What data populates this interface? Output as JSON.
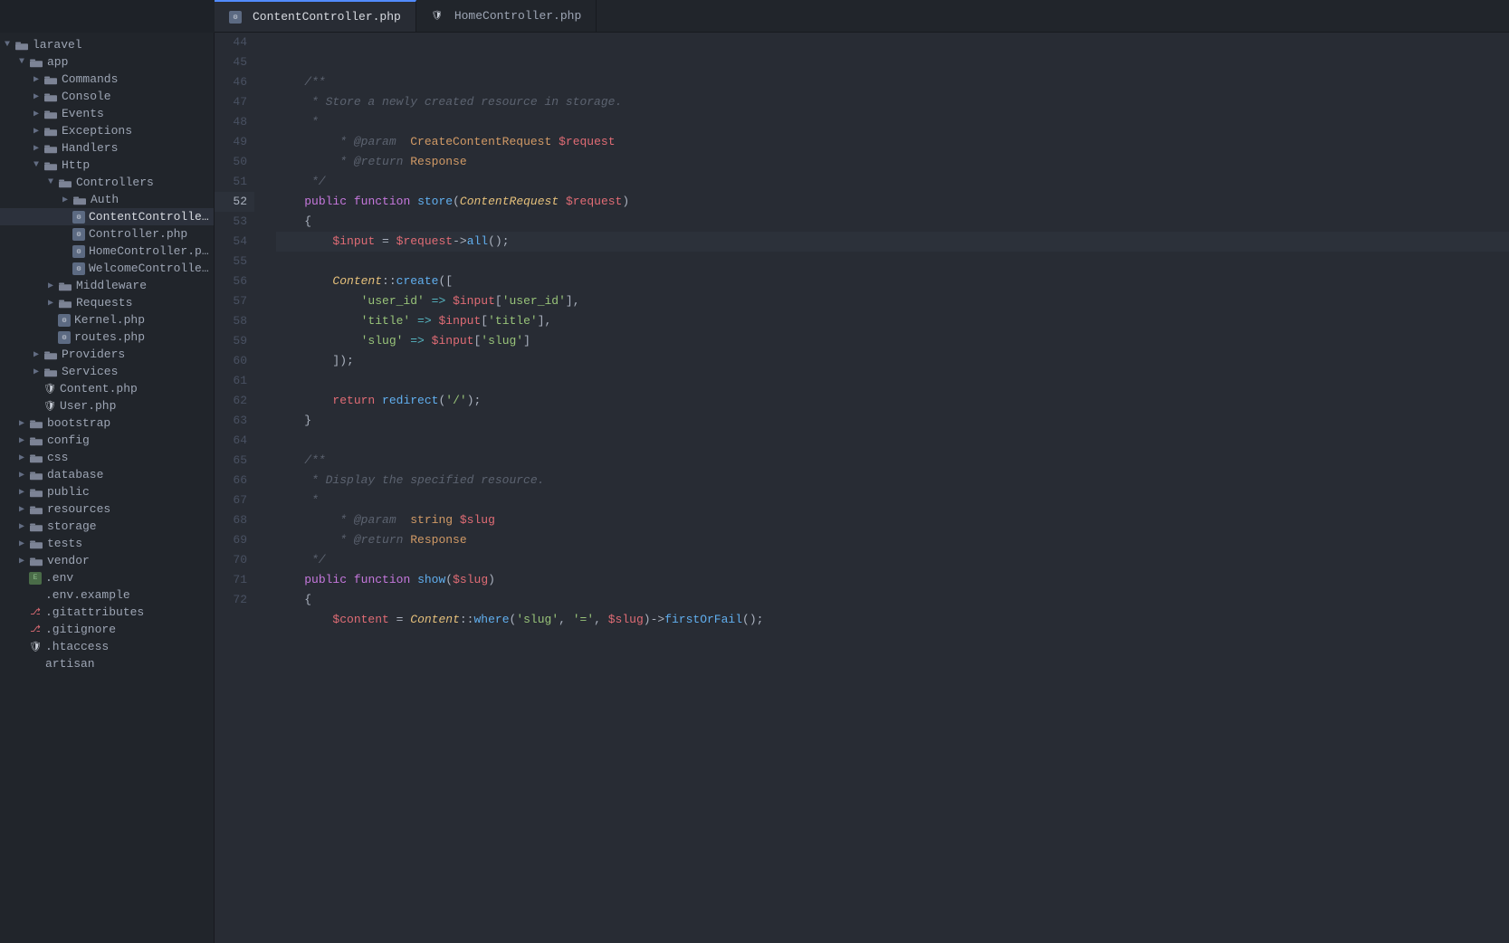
{
  "tabs": [
    {
      "id": "content-controller",
      "label": "ContentController.php",
      "icon": "php",
      "active": true
    },
    {
      "id": "home-controller",
      "label": "HomeController.php",
      "icon": "shield",
      "active": false
    }
  ],
  "sidebar": {
    "tree": [
      {
        "id": "laravel",
        "label": "laravel",
        "type": "folder",
        "level": 0,
        "open": true,
        "arrow": "open"
      },
      {
        "id": "app",
        "label": "app",
        "type": "folder",
        "level": 1,
        "open": true,
        "arrow": "open"
      },
      {
        "id": "commands",
        "label": "Commands",
        "type": "folder",
        "level": 2,
        "open": false,
        "arrow": "closed"
      },
      {
        "id": "console",
        "label": "Console",
        "type": "folder",
        "level": 2,
        "open": false,
        "arrow": "closed"
      },
      {
        "id": "events",
        "label": "Events",
        "type": "folder",
        "level": 2,
        "open": false,
        "arrow": "closed"
      },
      {
        "id": "exceptions",
        "label": "Exceptions",
        "type": "folder",
        "level": 2,
        "open": false,
        "arrow": "closed"
      },
      {
        "id": "handlers",
        "label": "Handlers",
        "type": "folder",
        "level": 2,
        "open": false,
        "arrow": "closed"
      },
      {
        "id": "http",
        "label": "Http",
        "type": "folder",
        "level": 2,
        "open": true,
        "arrow": "open"
      },
      {
        "id": "controllers",
        "label": "Controllers",
        "type": "folder",
        "level": 3,
        "open": true,
        "arrow": "open"
      },
      {
        "id": "auth",
        "label": "Auth",
        "type": "folder",
        "level": 4,
        "open": false,
        "arrow": "closed"
      },
      {
        "id": "contentcontroller",
        "label": "ContentController.php",
        "type": "php",
        "level": 4,
        "active": true
      },
      {
        "id": "controller",
        "label": "Controller.php",
        "type": "php",
        "level": 4
      },
      {
        "id": "homecontroller",
        "label": "HomeController.php",
        "type": "php",
        "level": 4
      },
      {
        "id": "welcomecontroller",
        "label": "WelcomeController.php",
        "type": "php",
        "level": 4
      },
      {
        "id": "middleware",
        "label": "Middleware",
        "type": "folder",
        "level": 3,
        "open": false,
        "arrow": "closed"
      },
      {
        "id": "requests",
        "label": "Requests",
        "type": "folder",
        "level": 3,
        "open": false,
        "arrow": "closed"
      },
      {
        "id": "kernel",
        "label": "Kernel.php",
        "type": "php",
        "level": 3
      },
      {
        "id": "routes",
        "label": "routes.php",
        "type": "php",
        "level": 3
      },
      {
        "id": "providers",
        "label": "Providers",
        "type": "folder",
        "level": 2,
        "open": false,
        "arrow": "closed"
      },
      {
        "id": "services",
        "label": "Services",
        "type": "folder",
        "level": 2,
        "open": false,
        "arrow": "closed"
      },
      {
        "id": "contentphp",
        "label": "Content.php",
        "type": "shield",
        "level": 2
      },
      {
        "id": "userphp",
        "label": "User.php",
        "type": "shield",
        "level": 2
      },
      {
        "id": "bootstrap",
        "label": "bootstrap",
        "type": "folder",
        "level": 1,
        "open": false,
        "arrow": "closed"
      },
      {
        "id": "config",
        "label": "config",
        "type": "folder",
        "level": 1,
        "open": false,
        "arrow": "closed"
      },
      {
        "id": "css",
        "label": "css",
        "type": "folder",
        "level": 1,
        "open": false,
        "arrow": "closed"
      },
      {
        "id": "database",
        "label": "database",
        "type": "folder",
        "level": 1,
        "open": false,
        "arrow": "closed"
      },
      {
        "id": "public",
        "label": "public",
        "type": "folder",
        "level": 1,
        "open": false,
        "arrow": "closed"
      },
      {
        "id": "resources",
        "label": "resources",
        "type": "folder",
        "level": 1,
        "open": false,
        "arrow": "closed"
      },
      {
        "id": "storage",
        "label": "storage",
        "type": "folder",
        "level": 1,
        "open": false,
        "arrow": "closed"
      },
      {
        "id": "tests",
        "label": "tests",
        "type": "folder",
        "level": 1,
        "open": false,
        "arrow": "closed"
      },
      {
        "id": "vendor",
        "label": "vendor",
        "type": "folder",
        "level": 1,
        "open": false,
        "arrow": "closed"
      },
      {
        "id": "envfile",
        "label": ".env",
        "type": "env",
        "level": 1
      },
      {
        "id": "envexample",
        "label": ".env.example",
        "type": "text",
        "level": 1
      },
      {
        "id": "gitattributes",
        "label": ".gitattributes",
        "type": "git",
        "level": 1
      },
      {
        "id": "gitignore",
        "label": ".gitignore",
        "type": "git",
        "level": 1
      },
      {
        "id": "htaccess",
        "label": ".htaccess",
        "type": "shield",
        "level": 1
      },
      {
        "id": "artisan",
        "label": "artisan",
        "type": "text",
        "level": 1
      }
    ]
  },
  "code": {
    "active_line": 52,
    "lines": [
      {
        "num": 44,
        "content": "    /**"
      },
      {
        "num": 45,
        "content": "     * Store a newly created resource in storage."
      },
      {
        "num": 46,
        "content": "     *"
      },
      {
        "num": 47,
        "content": "     * @param  CreateContentRequest $request"
      },
      {
        "num": 48,
        "content": "     * @return Response"
      },
      {
        "num": 49,
        "content": "     */"
      },
      {
        "num": 50,
        "content": "    public function store(ContentRequest $request)"
      },
      {
        "num": 51,
        "content": "    {"
      },
      {
        "num": 52,
        "content": "        $input = $request->all();"
      },
      {
        "num": 53,
        "content": ""
      },
      {
        "num": 54,
        "content": "        Content::create(["
      },
      {
        "num": 55,
        "content": "            'user_id' => $input['user_id'],"
      },
      {
        "num": 56,
        "content": "            'title' => $input['title'],"
      },
      {
        "num": 57,
        "content": "            'slug' => $input['slug']"
      },
      {
        "num": 58,
        "content": "        ]);"
      },
      {
        "num": 59,
        "content": ""
      },
      {
        "num": 60,
        "content": "        return redirect('/');"
      },
      {
        "num": 61,
        "content": "    }"
      },
      {
        "num": 62,
        "content": ""
      },
      {
        "num": 63,
        "content": "    /**"
      },
      {
        "num": 64,
        "content": "     * Display the specified resource."
      },
      {
        "num": 65,
        "content": "     *"
      },
      {
        "num": 66,
        "content": "     * @param  string $slug"
      },
      {
        "num": 67,
        "content": "     * @return Response"
      },
      {
        "num": 68,
        "content": "     */"
      },
      {
        "num": 69,
        "content": "    public function show($slug)"
      },
      {
        "num": 70,
        "content": "    {"
      },
      {
        "num": 71,
        "content": "        $content = Content::where('slug', '=', $slug)->firstOrFail();"
      },
      {
        "num": 72,
        "content": ""
      }
    ]
  }
}
